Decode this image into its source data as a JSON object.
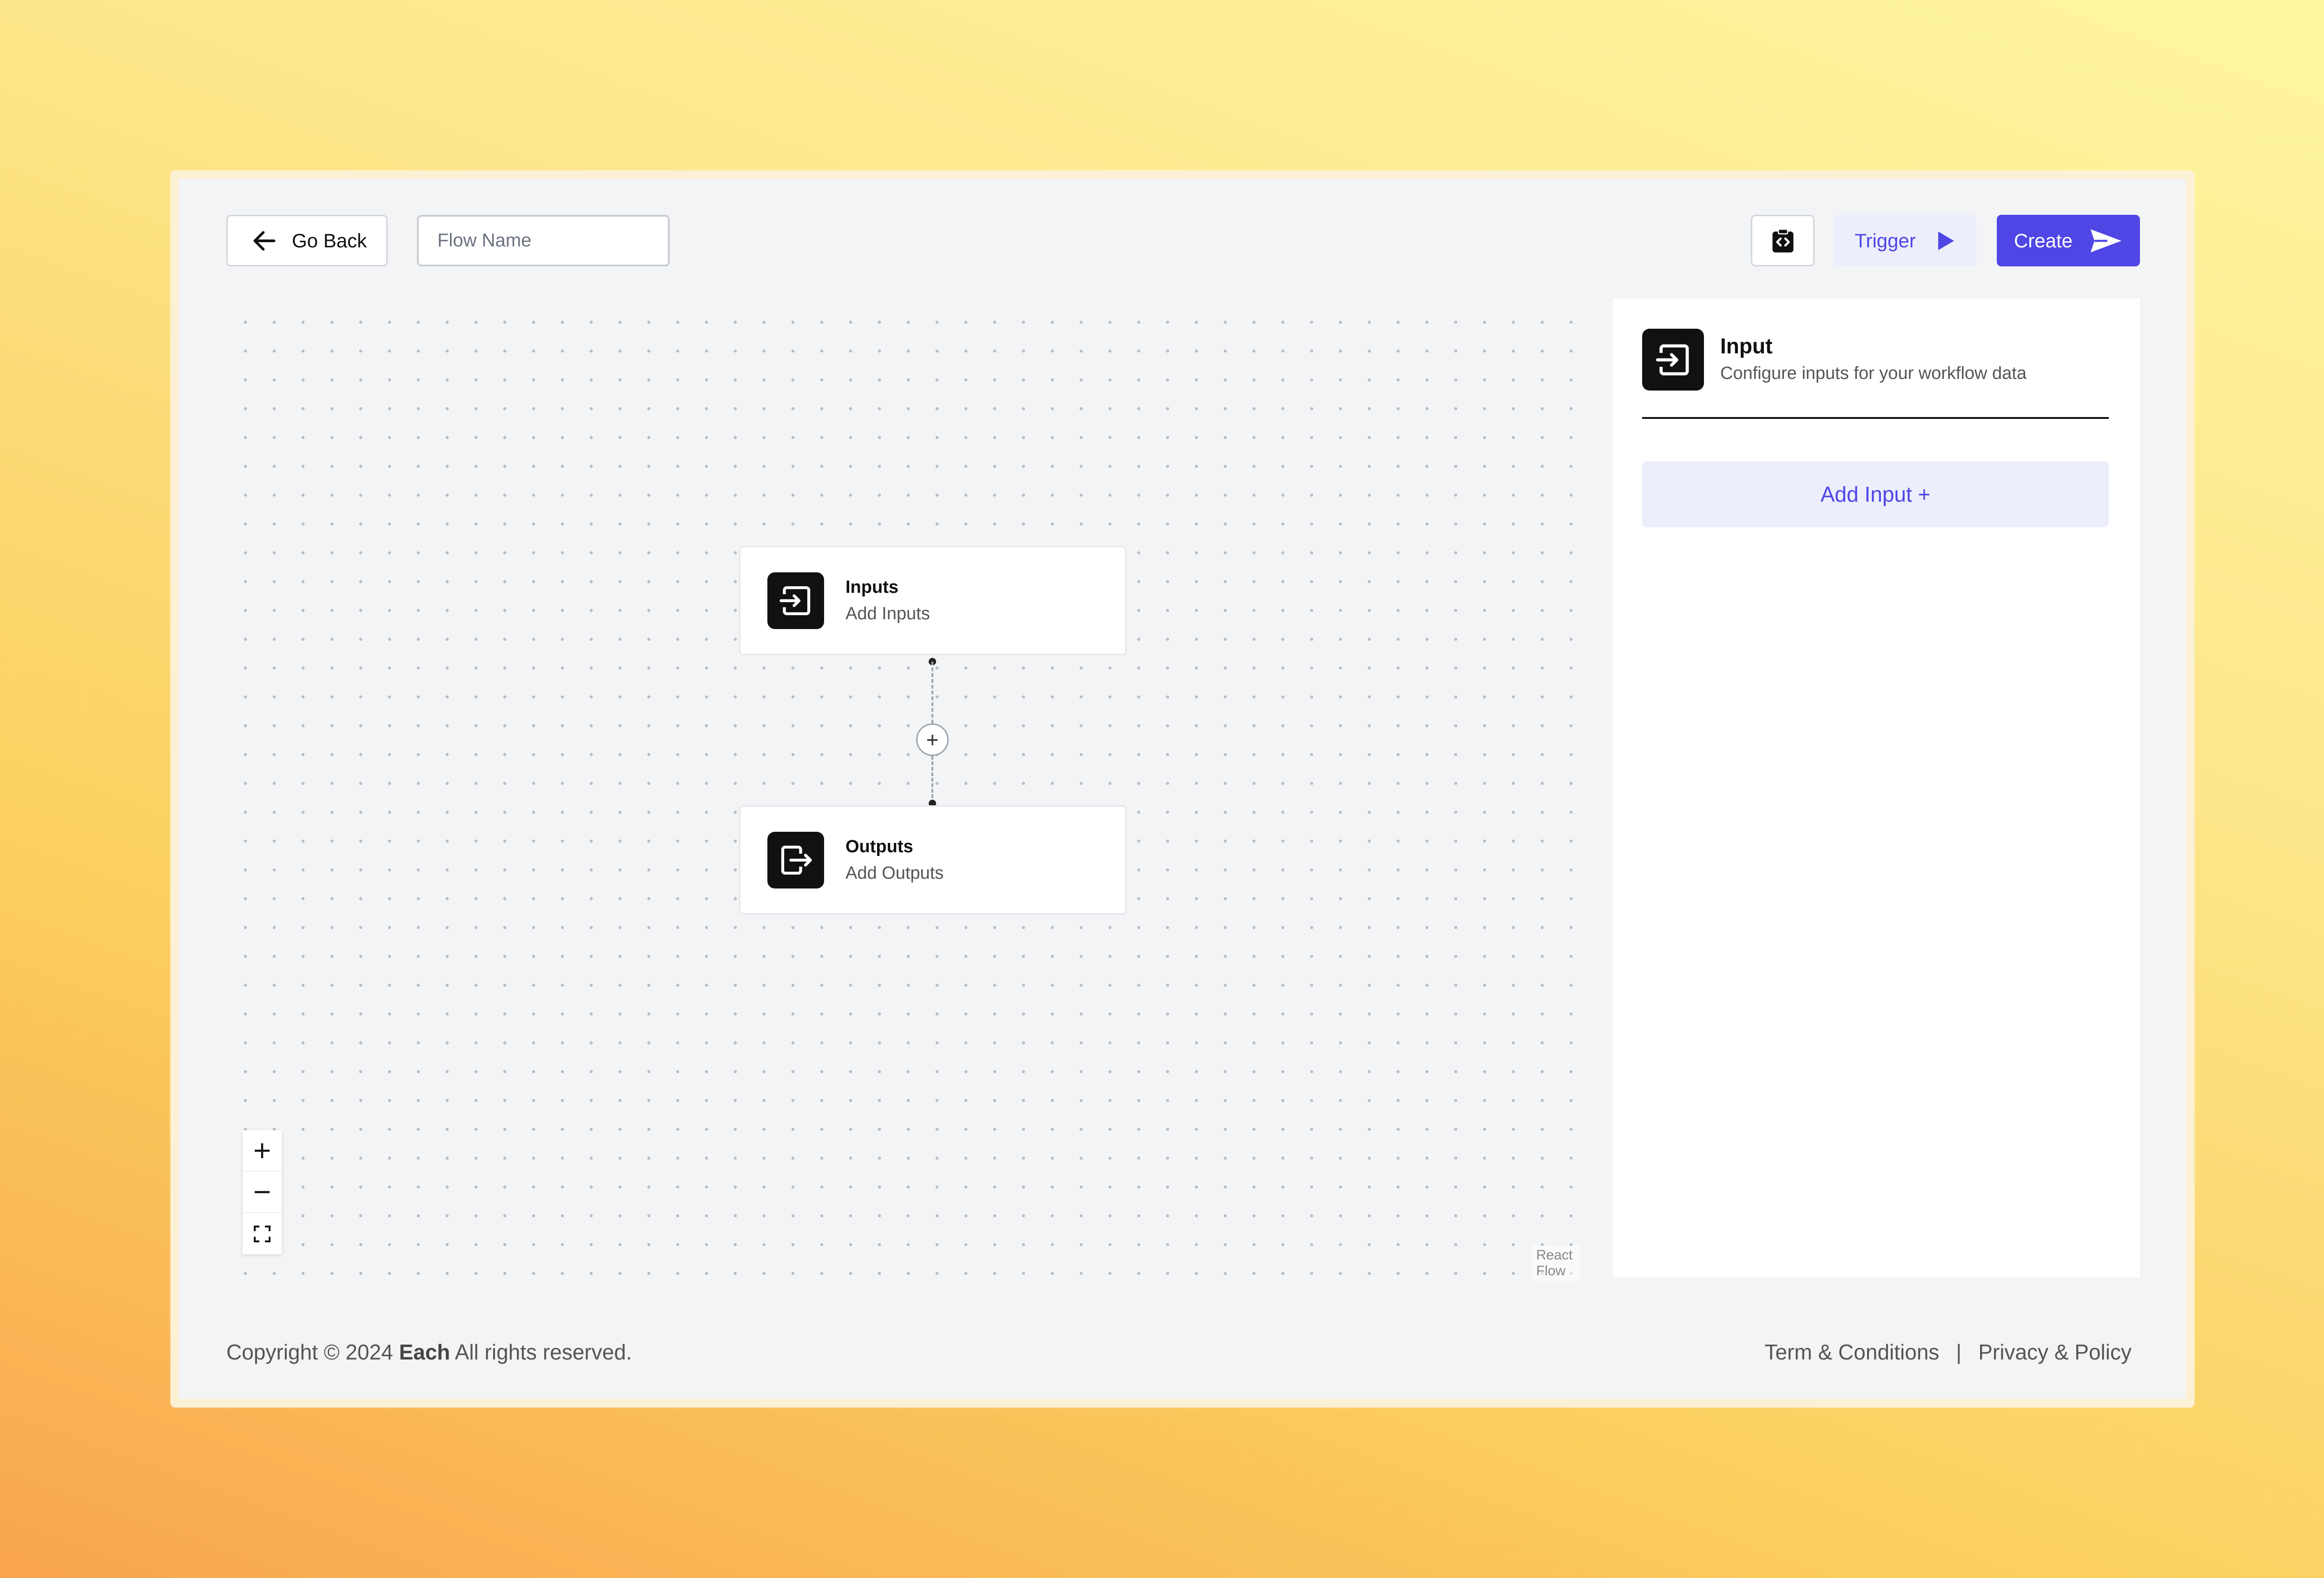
{
  "header": {
    "back_label": "Go Back",
    "flow_name_placeholder": "Flow Name",
    "flow_name_value": "",
    "trigger_label": "Trigger",
    "create_label": "Create"
  },
  "canvas": {
    "nodes": [
      {
        "title": "Inputs",
        "subtitle": "Add Inputs"
      },
      {
        "title": "Outputs",
        "subtitle": "Add Outputs"
      }
    ],
    "add_node_symbol": "+",
    "controls": [
      "zoom-in",
      "zoom-out",
      "fit-view"
    ],
    "attribution": "React Flow"
  },
  "panel": {
    "title": "Input",
    "subtitle": "Configure inputs for your workflow data",
    "add_button_label": "Add Input +"
  },
  "footer": {
    "copyright_prefix": "Copyright © 2024",
    "brand": "Each",
    "copyright_suffix": "All rights reserved.",
    "terms_label": "Term & Conditions",
    "separator": "|",
    "privacy_label": "Privacy & Policy"
  },
  "colors": {
    "accent": "#4f46e5",
    "accent_light": "#eceefc"
  }
}
